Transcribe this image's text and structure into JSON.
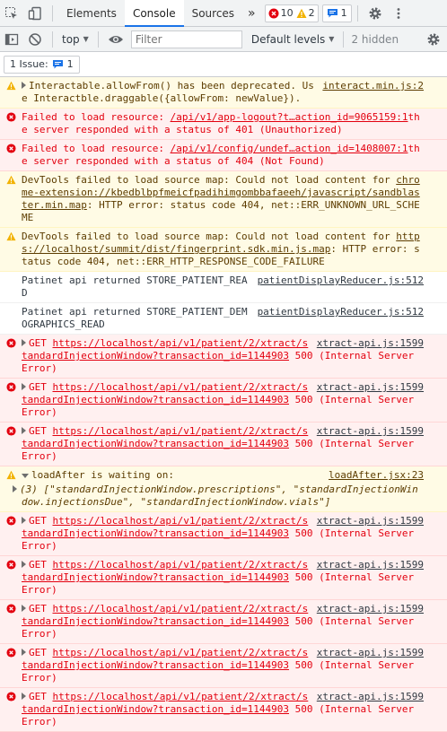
{
  "tabbar": {
    "tabs": [
      "Elements",
      "Console",
      "Sources"
    ],
    "more": "»",
    "errors_count": "10",
    "warnings_count": "2",
    "info_count": "1"
  },
  "toolbar": {
    "context": "top",
    "filter_placeholder": "Filter",
    "levels": "Default levels",
    "hidden": "2 hidden"
  },
  "issues": {
    "label": "1 Issue:",
    "count": "1"
  },
  "entries": [
    {
      "type": "warning",
      "text": "Interactable.allowFrom() has been deprecated. Use Interactble.draggable({allowFrom: newValue}).",
      "src": "interact.min.js:2"
    },
    {
      "type": "error",
      "pre": "Failed to load resource: ",
      "link": "/api/v1/app-logout?t…action_id=9065159:1",
      "post": "the server responded with a status of 401 (Unauthorized)"
    },
    {
      "type": "error",
      "pre": "Failed to load resource: ",
      "link": "/api/v1/config/undef…action_id=1408007:1",
      "post": "the server responded with a status of 404 (Not Found)"
    },
    {
      "type": "warning",
      "pre": "DevTools failed to load source map: Could not load content for ",
      "link": "chrome-extension://kbedblbpfmeicfpadihimgombbafaeeh/javascript/sandblaster.min.map",
      "post": ": HTTP error: status code 404, net::ERR_UNKNOWN_URL_SCHEME"
    },
    {
      "type": "warning",
      "pre": "DevTools failed to load source map: Could not load content for ",
      "link": "https://localhost/summit/dist/fingerprint.sdk.min.js.map",
      "post": ": HTTP error: status code 404, net::ERR_HTTP_RESPONSE_CODE_FAILURE"
    },
    {
      "type": "info",
      "text": "Patinet api returned STORE_PATIENT_READ",
      "src": "patientDisplayReducer.js:512"
    },
    {
      "type": "info",
      "text": "Patinet api returned STORE_PATIENT_DEMOGRAPHICS_READ",
      "src": "patientDisplayReducer.js:512"
    },
    {
      "type": "error",
      "get": "GET",
      "link": "https://localhost/api/v1/patient/2/xtract/standardInjectionWindow?transaction_id=1144903",
      "post": " 500 (Internal Server Error)",
      "src": "xtract-api.js:1599"
    },
    {
      "type": "error",
      "get": "GET",
      "link": "https://localhost/api/v1/patient/2/xtract/standardInjectionWindow?transaction_id=1144903",
      "post": " 500 (Internal Server Error)",
      "src": "xtract-api.js:1599"
    },
    {
      "type": "error",
      "get": "GET",
      "link": "https://localhost/api/v1/patient/2/xtract/standardInjectionWindow?transaction_id=1144903",
      "post": " 500 (Internal Server Error)",
      "src": "xtract-api.js:1599"
    },
    {
      "type": "warning",
      "text": "loadAfter is waiting on:",
      "src": "loadAfter.jsx:23",
      "array": "(3) [\"standardInjectionWindow.prescriptions\", \"standardInjectionWindow.injectionsDue\", \"standardInjectionWindow.vials\"]"
    },
    {
      "type": "error",
      "get": "GET",
      "link": "https://localhost/api/v1/patient/2/xtract/standardInjectionWindow?transaction_id=1144903",
      "post": " 500 (Internal Server Error)",
      "src": "xtract-api.js:1599"
    },
    {
      "type": "error",
      "get": "GET",
      "link": "https://localhost/api/v1/patient/2/xtract/standardInjectionWindow?transaction_id=1144903",
      "post": " 500 (Internal Server Error)",
      "src": "xtract-api.js:1599"
    },
    {
      "type": "error",
      "get": "GET",
      "link": "https://localhost/api/v1/patient/2/xtract/standardInjectionWindow?transaction_id=1144903",
      "post": " 500 (Internal Server Error)",
      "src": "xtract-api.js:1599"
    },
    {
      "type": "error",
      "get": "GET",
      "link": "https://localhost/api/v1/patient/2/xtract/standardInjectionWindow?transaction_id=1144903",
      "post": " 500 (Internal Server Error)",
      "src": "xtract-api.js:1599"
    },
    {
      "type": "error",
      "get": "GET",
      "link": "https://localhost/api/v1/patient/2/xtract/standardInjectionWindow?transaction_id=1144903",
      "post": " 500 (Internal Server Error)",
      "src": "xtract-api.js:1599"
    }
  ]
}
